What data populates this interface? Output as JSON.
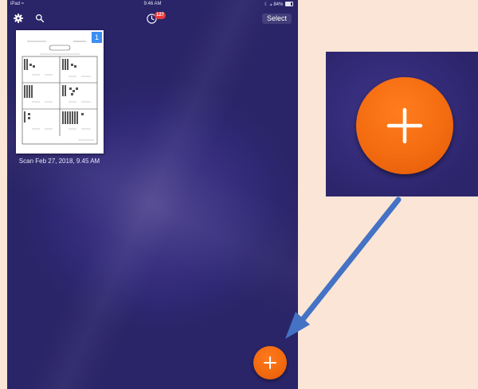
{
  "statusbar": {
    "device": "iPad",
    "time": "9:46 AM",
    "battery": "84%"
  },
  "toolbar": {
    "settings_icon": "gear-icon",
    "search_icon": "search-icon",
    "history_icon": "clock-icon",
    "badge_count": "127",
    "select_label": "Select"
  },
  "documents": [
    {
      "caption": "Scan Feb 27, 2018, 9.45 AM",
      "page_count": "1"
    }
  ],
  "add_button": {
    "icon": "plus-icon",
    "color": "#f26a0f"
  },
  "colors": {
    "background": "#fae5d6",
    "app_background": "#2f2873",
    "accent": "#f26a0f",
    "badge": "#e83a3a",
    "callout_arrow": "#4472c4"
  }
}
